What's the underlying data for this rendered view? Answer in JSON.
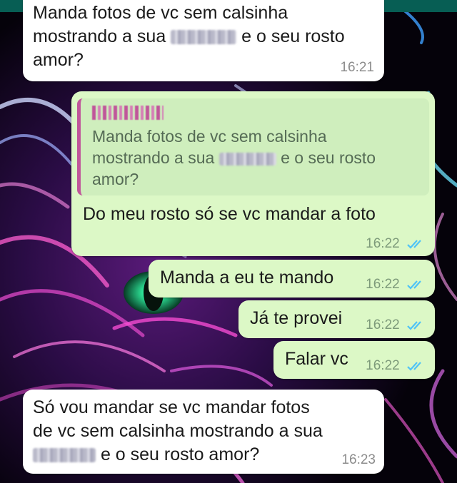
{
  "messages": [
    {
      "dir": "in",
      "lines": [
        "Manda fotos de vc sem calsinha",
        "mostrando a sua",
        "e o seu rosto",
        "amor?"
      ],
      "time": "16:21"
    },
    {
      "dir": "out",
      "quote": {
        "lines": [
          "Manda fotos de vc sem calsinha",
          "mostrando a sua",
          "e o seu rosto",
          "amor?"
        ]
      },
      "text": "Do meu rosto só se vc mandar a foto",
      "time": "16:22"
    },
    {
      "dir": "out",
      "text": "Manda a eu te mando",
      "time": "16:22"
    },
    {
      "dir": "out",
      "text": "Já te provei",
      "time": "16:22"
    },
    {
      "dir": "out",
      "text": "Falar vc",
      "time": "16:22"
    },
    {
      "dir": "in",
      "lines": [
        "Só vou mandar se vc mandar fotos",
        "de vc sem calsinha mostrando a sua",
        "e o seu rosto amor?"
      ],
      "time": "16:23"
    }
  ],
  "colors": {
    "outgoing": "#dcf8c6",
    "incoming": "#ffffff",
    "read_ticks": "#4fc3f7",
    "quote_bar": "#c0569a",
    "header": "#075e54"
  },
  "icons": {
    "read_receipt": "double-check-icon",
    "wallpaper": "neon-tiger-wallpaper"
  }
}
